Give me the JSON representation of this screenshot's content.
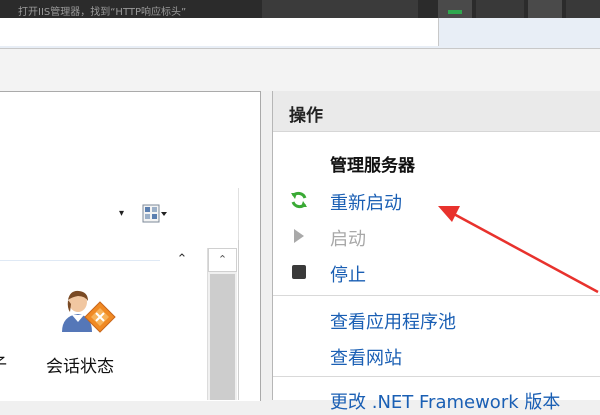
{
  "top_caption": "打开IIS管理器，找到“HTTP响应标头”",
  "content": {
    "feature_label": "会话状态",
    "partial_label": "子",
    "collapse_glyph": "⌃",
    "scroll_up_glyph": "⌃",
    "dropdown_glyph": "▾"
  },
  "actions": {
    "header": "操作",
    "section_title": "管理服务器",
    "items": [
      {
        "label": "重新启动",
        "icon": "restart-icon",
        "enabled": true
      },
      {
        "label": "启动",
        "icon": "start-icon",
        "enabled": false
      },
      {
        "label": "停止",
        "icon": "stop-icon",
        "enabled": true
      },
      {
        "label": "查看应用程序池",
        "icon": "",
        "enabled": true
      },
      {
        "label": "查看网站",
        "icon": "",
        "enabled": true
      },
      {
        "label": "更改 .NET Framework 版本",
        "icon": "",
        "enabled": true
      }
    ]
  },
  "colors": {
    "link": "#1a5fb4",
    "disabled": "#a8a8a8",
    "annotation": "#e8322d",
    "restart_green": "#3aaa35"
  }
}
